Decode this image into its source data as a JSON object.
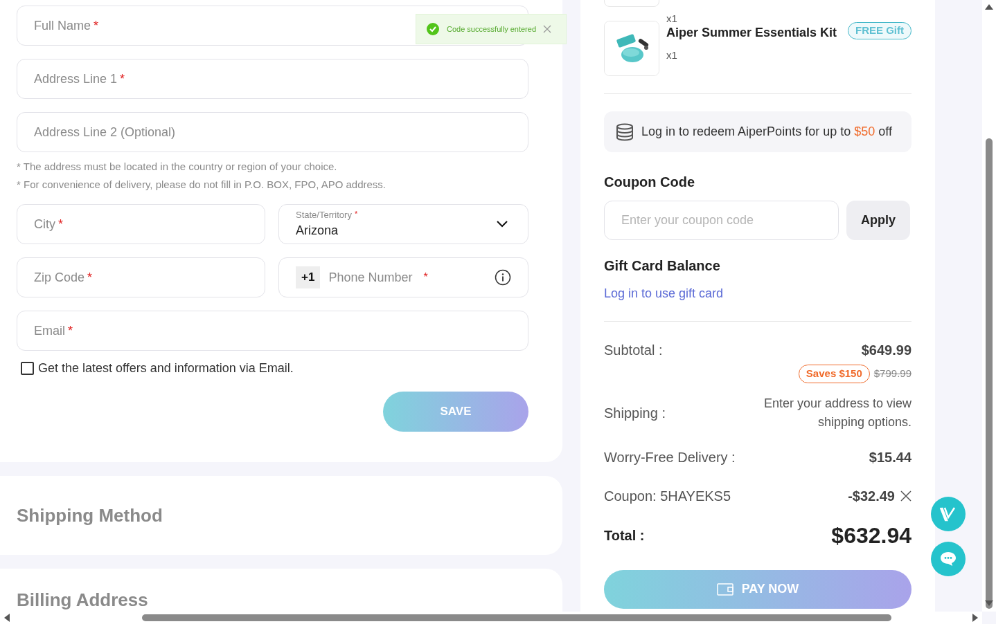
{
  "address_form": {
    "fields": [
      {
        "placeholder": "Full Name",
        "required_mark": "*"
      },
      {
        "placeholder": "Address Line 1",
        "required_mark": "*"
      },
      {
        "placeholder": "Address Line 2 (Optional)"
      }
    ],
    "notes": [
      "* The address must be located in the country or region of your choice.",
      "* For convenience of delivery, please do not fill in P.O. BOX, FPO, APO address."
    ],
    "city": {
      "placeholder": "City",
      "required_mark": "*"
    },
    "state": {
      "label": "State/Territory",
      "required_mark": "*",
      "value": "Arizona"
    },
    "zip": {
      "placeholder": "Zip Code",
      "required_mark": "*"
    },
    "phone": {
      "prefix": "+1",
      "placeholder": "Phone Number",
      "required_mark": "*"
    },
    "email": {
      "placeholder": "Email",
      "required_mark": "*"
    },
    "newsletter": {
      "label": "Get the latest offers and information via Email.",
      "checked": false
    },
    "save_button": "SAVE"
  },
  "sections": [
    "Shipping Method",
    "Billing Address"
  ],
  "toast": {
    "message": "Code successfully entered"
  },
  "order_items": [
    {
      "kind": "cut",
      "quantity": "x1"
    },
    {
      "kind": "full",
      "name": "Aiper Summer Essentials Kit",
      "badge": "FREE Gift",
      "quantity": "x1"
    }
  ],
  "points_banner": {
    "text": "Log in to redeem AiperPoints for up to",
    "amount": "$50",
    "suffix": "off"
  },
  "coupon": {
    "heading": "Coupon Code",
    "placeholder": "Enter your coupon code",
    "button": "Apply"
  },
  "gift_card": {
    "heading": "Gift Card Balance",
    "link": "Log in to use gift card"
  },
  "summary": {
    "subtotal_label": "Subtotal :",
    "subtotal": "$649.99",
    "saves": "Saves $150",
    "original": "$799.99",
    "shipping_label": "Shipping :",
    "shipping_note": "Enter your address to view shipping options.",
    "delivery_label": "Worry-Free Delivery :",
    "delivery": "$15.44",
    "coupon_label": "Coupon: 5HAYEKS5",
    "coupon_amount": "-$32.49",
    "total_label": "Total :",
    "total": "$632.94"
  },
  "pay_button": "PAY NOW"
}
